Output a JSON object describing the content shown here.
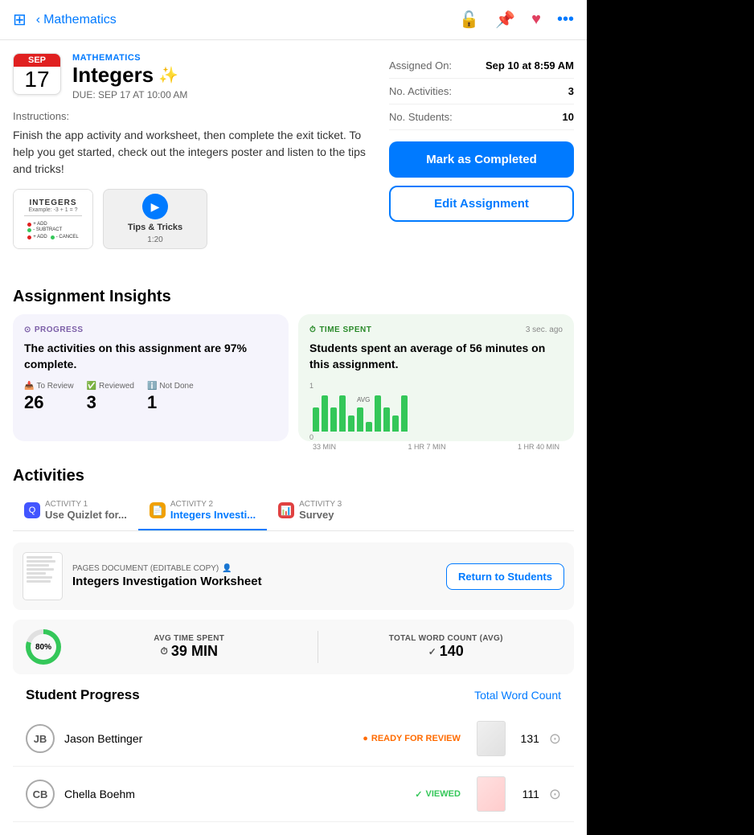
{
  "nav": {
    "sidebar_icon": "≡",
    "back_label": "Mathematics",
    "icons": {
      "lock": "🔒",
      "pin": "📌",
      "heart": "♥",
      "more": "···"
    }
  },
  "assignment": {
    "month": "SEP",
    "day": "17",
    "subject": "MATHEMATICS",
    "title": "Integers",
    "sparkle": "✨",
    "due": "DUE: SEP 17 AT 10:00 AM",
    "instructions_label": "Instructions:",
    "instructions": "Finish the app activity and worksheet, then complete the exit ticket. To help you get started, check out the integers poster and listen to the tips and tricks!",
    "video_label": "Tips & Tricks",
    "video_duration": "1:20"
  },
  "meta": {
    "assigned_on_label": "Assigned On:",
    "assigned_on_value": "Sep 10 at 8:59 AM",
    "activities_label": "No. Activities:",
    "activities_value": "3",
    "students_label": "No. Students:",
    "students_value": "10"
  },
  "buttons": {
    "mark_completed": "Mark as Completed",
    "edit_assignment": "Edit Assignment"
  },
  "insights": {
    "section_title": "Assignment Insights",
    "progress": {
      "tag": "PROGRESS",
      "text": "The activities on this assignment are 97% complete.",
      "to_review_label": "To Review",
      "to_review_value": "26",
      "reviewed_label": "Reviewed",
      "reviewed_value": "3",
      "not_done_label": "Not Done",
      "not_done_value": "1"
    },
    "time": {
      "tag": "TIME SPENT",
      "timestamp": "3 sec. ago",
      "text": "Students spent an average of 56 minutes on this assignment.",
      "chart_labels": [
        "33 MIN",
        "1 HR 7 MIN",
        "1 HR 40 MIN"
      ],
      "chart_y": [
        "1",
        "0"
      ]
    }
  },
  "activities": {
    "section_title": "Activities",
    "tabs": [
      {
        "label_small": "ACTIVITY 1",
        "label_main": "Use Quizlet for...",
        "icon_type": "quizlet",
        "icon": "Q"
      },
      {
        "label_small": "ACTIVITY 2",
        "label_main": "Integers Investi...",
        "icon_type": "pages",
        "icon": "P"
      },
      {
        "label_small": "ACTIVITY 3",
        "label_main": "Survey",
        "icon_type": "survey",
        "icon": "S"
      }
    ],
    "doc": {
      "type": "PAGES DOCUMENT (EDITABLE COPY)",
      "name": "Integers Investigation Worksheet",
      "return_btn": "Return to Students"
    },
    "metrics": {
      "percent": "80%",
      "avg_time_label": "AVG TIME SPENT",
      "avg_time_value": "39 MIN",
      "total_wc_label": "TOTAL WORD COUNT (AVG)",
      "total_wc_value": "140"
    },
    "student_progress": {
      "title": "Student Progress",
      "total_wc_link": "Total Word Count",
      "students": [
        {
          "initials": "JB",
          "name": "Jason Bettinger",
          "status": "READY FOR REVIEW",
          "status_type": "review",
          "word_count": "131"
        },
        {
          "initials": "CB",
          "name": "Chella Boehm",
          "status": "VIEWED",
          "status_type": "viewed",
          "word_count": "111"
        }
      ]
    }
  }
}
